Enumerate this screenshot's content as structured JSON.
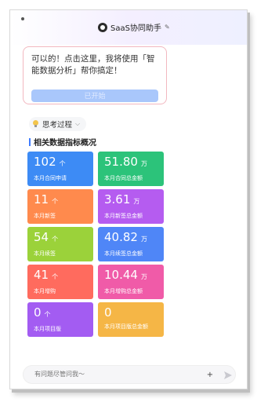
{
  "header": {
    "title": "SaaS协同助手",
    "subtitle": "✎"
  },
  "message": {
    "text": "可以的！点击这里，我将使用「智能数据分析」帮你搞定！",
    "button_label": "已开始"
  },
  "thinking": {
    "label": "思考过程"
  },
  "section": {
    "title": "相关数据指标概况"
  },
  "metrics": [
    {
      "value": "102",
      "unit": "个",
      "label": "本月合同申请",
      "color": "#3d8bf5"
    },
    {
      "value": "51.80",
      "unit": "万",
      "label": "本月合同总金额",
      "color": "#2cc37a"
    },
    {
      "value": "11",
      "unit": "个",
      "label": "本月新签",
      "color": "#ff8a4d"
    },
    {
      "value": "3.61",
      "unit": "万",
      "label": "本月新签总金额",
      "color": "#b55cf0"
    },
    {
      "value": "54",
      "unit": "个",
      "label": "本月续签",
      "color": "#9bd23a"
    },
    {
      "value": "40.82",
      "unit": "万",
      "label": "本月续签总金额",
      "color": "#4f86f7"
    },
    {
      "value": "41",
      "unit": "个",
      "label": "本月增购",
      "color": "#ff6b5e"
    },
    {
      "value": "10.44",
      "unit": "万",
      "label": "本月增购总金额",
      "color": "#f05ba8"
    },
    {
      "value": "0",
      "unit": "个",
      "label": "本月项目版",
      "color": "#a35cf2"
    },
    {
      "value": "0",
      "unit": "",
      "label": "本月项目版总金额",
      "color": "#f5b646"
    }
  ],
  "input": {
    "placeholder": "有问题尽管问我～",
    "plus_label": "+"
  }
}
